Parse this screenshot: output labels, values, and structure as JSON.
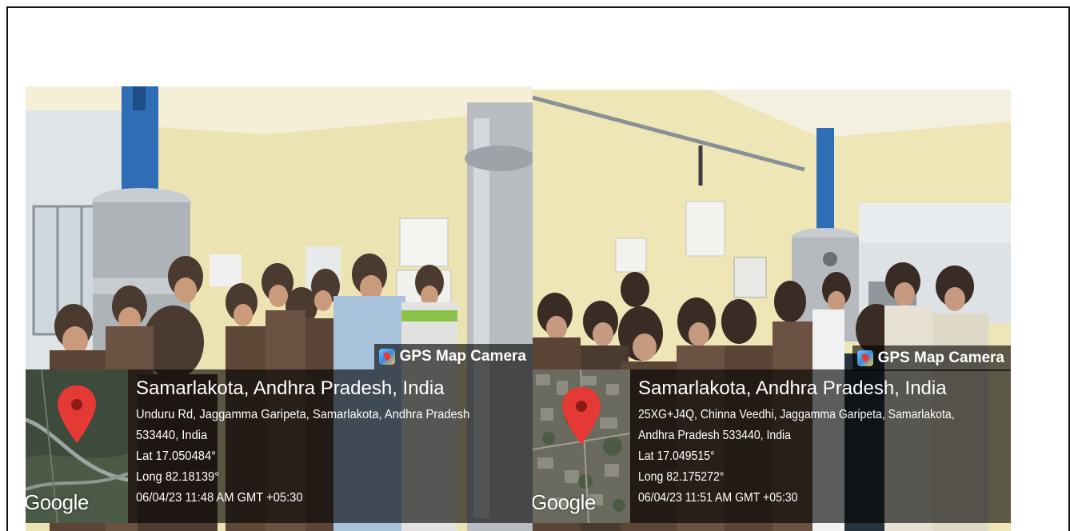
{
  "photos": [
    {
      "badge": "GPS Map Camera",
      "place": "Samarlakota, Andhra Pradesh, India",
      "address_line_1": "Unduru Rd, Jaggamma Garipeta, Samarlakota, Andhra Pradesh",
      "address_line_2": "533440, India",
      "lat": "Lat 17.050484°",
      "long": "Long 82.18139°",
      "datetime": "06/04/23 11:48 AM GMT +05:30",
      "map_logo": "Google",
      "map_icon": "map-pin-icon"
    },
    {
      "badge": "GPS Map Camera",
      "place": "Samarlakota, Andhra Pradesh, India",
      "address_line_1": "25XG+J4Q, Chinna Veedhi, Jaggamma Garipeta, Samarlakota,",
      "address_line_2": "Andhra Pradesh 533440, India",
      "lat": "Lat 17.049515°",
      "long": "Long 82.175272°",
      "datetime": "06/04/23 11:51 AM GMT +05:30",
      "map_logo": "Google",
      "map_icon": "map-pin-icon"
    }
  ],
  "colors": {
    "pin": "#e53935",
    "overlay": "#000000",
    "wall": "#efe6b8",
    "steel": "#b9bcc0",
    "vessel_blue": "#2f6db5"
  }
}
